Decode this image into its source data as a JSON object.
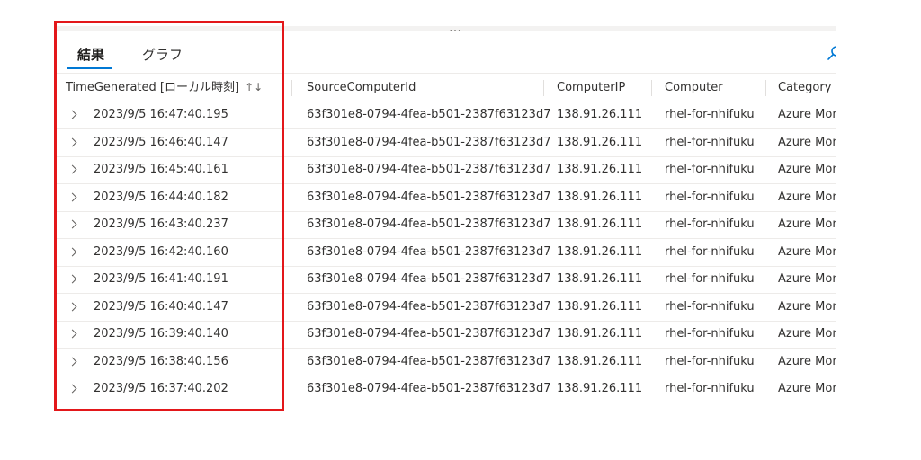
{
  "tabs": {
    "results": "結果",
    "chart": "グラフ"
  },
  "drag_handle": "…",
  "columns": {
    "time": "TimeGenerated [ローカル時刻]",
    "source_computer_id": "SourceComputerId",
    "computer_ip": "ComputerIP",
    "computer": "Computer",
    "category": "Category"
  },
  "sort_icon": "↑↓",
  "rows": [
    {
      "time": "2023/9/5 16:47:40.195",
      "source": "63f301e8-0794-4fea-b501-2387f63123d7",
      "ip": "138.91.26.111",
      "computer": "rhel-for-nhifuku",
      "category": "Azure Mon"
    },
    {
      "time": "2023/9/5 16:46:40.147",
      "source": "63f301e8-0794-4fea-b501-2387f63123d7",
      "ip": "138.91.26.111",
      "computer": "rhel-for-nhifuku",
      "category": "Azure Mon"
    },
    {
      "time": "2023/9/5 16:45:40.161",
      "source": "63f301e8-0794-4fea-b501-2387f63123d7",
      "ip": "138.91.26.111",
      "computer": "rhel-for-nhifuku",
      "category": "Azure Mon"
    },
    {
      "time": "2023/9/5 16:44:40.182",
      "source": "63f301e8-0794-4fea-b501-2387f63123d7",
      "ip": "138.91.26.111",
      "computer": "rhel-for-nhifuku",
      "category": "Azure Mon"
    },
    {
      "time": "2023/9/5 16:43:40.237",
      "source": "63f301e8-0794-4fea-b501-2387f63123d7",
      "ip": "138.91.26.111",
      "computer": "rhel-for-nhifuku",
      "category": "Azure Mon"
    },
    {
      "time": "2023/9/5 16:42:40.160",
      "source": "63f301e8-0794-4fea-b501-2387f63123d7",
      "ip": "138.91.26.111",
      "computer": "rhel-for-nhifuku",
      "category": "Azure Mon"
    },
    {
      "time": "2023/9/5 16:41:40.191",
      "source": "63f301e8-0794-4fea-b501-2387f63123d7",
      "ip": "138.91.26.111",
      "computer": "rhel-for-nhifuku",
      "category": "Azure Mon"
    },
    {
      "time": "2023/9/5 16:40:40.147",
      "source": "63f301e8-0794-4fea-b501-2387f63123d7",
      "ip": "138.91.26.111",
      "computer": "rhel-for-nhifuku",
      "category": "Azure Mon"
    },
    {
      "time": "2023/9/5 16:39:40.140",
      "source": "63f301e8-0794-4fea-b501-2387f63123d7",
      "ip": "138.91.26.111",
      "computer": "rhel-for-nhifuku",
      "category": "Azure Mon"
    },
    {
      "time": "2023/9/5 16:38:40.156",
      "source": "63f301e8-0794-4fea-b501-2387f63123d7",
      "ip": "138.91.26.111",
      "computer": "rhel-for-nhifuku",
      "category": "Azure Mon"
    },
    {
      "time": "2023/9/5 16:37:40.202",
      "source": "63f301e8-0794-4fea-b501-2387f63123d7",
      "ip": "138.91.26.111",
      "computer": "rhel-for-nhifuku",
      "category": "Azure Mon"
    }
  ],
  "colors": {
    "accent": "#0078d4",
    "highlight": "#e3171a"
  },
  "icons": {
    "search": "search-icon",
    "expand": "chevron-right-icon",
    "sort": "sort-icon"
  }
}
